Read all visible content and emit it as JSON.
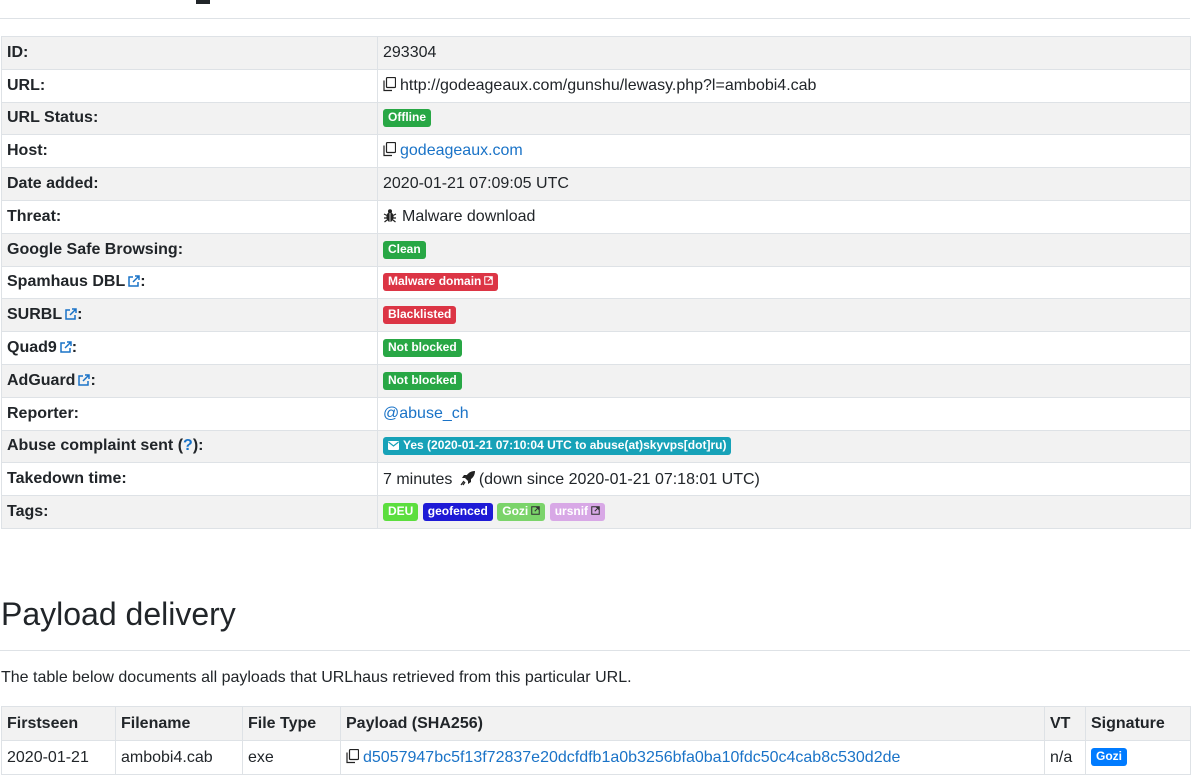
{
  "info_rows": {
    "id": {
      "label": "ID:",
      "value": "293304"
    },
    "url": {
      "label": "URL:",
      "value": "http://godeageaux.com/gunshu/lewasy.php?l=ambobi4.cab"
    },
    "url_status": {
      "label": "URL Status:",
      "badge": "Offline"
    },
    "host": {
      "label": "Host:",
      "value": "godeageaux.com"
    },
    "date_added": {
      "label": "Date added:",
      "value": "2020-01-21 07:09:05 UTC"
    },
    "threat": {
      "label": "Threat:",
      "value": "Malware download"
    },
    "google_safe_browsing": {
      "label": "Google Safe Browsing:",
      "badge": "Clean"
    },
    "spamhaus_dbl": {
      "label": "Spamhaus DBL",
      "badge": "Malware domain"
    },
    "surbl": {
      "label": "SURBL",
      "badge": "Blacklisted"
    },
    "quad9": {
      "label": "Quad9",
      "badge": "Not blocked"
    },
    "adguard": {
      "label": "AdGuard",
      "badge": "Not blocked"
    },
    "reporter": {
      "label": "Reporter:",
      "value": "@abuse_ch"
    },
    "abuse_complaint": {
      "label_prefix": "Abuse complaint sent (",
      "help": "?",
      "label_suffix": "):",
      "badge": "Yes (2020-01-21 07:10:04 UTC to abuse(at)skyvps[dot]ru)"
    },
    "takedown": {
      "label": "Takedown time:",
      "value_prefix": "7 minutes",
      "value_suffix": "(down since 2020-01-21 07:18:01 UTC)"
    },
    "tags": {
      "label": "Tags:",
      "items": [
        {
          "text": "DEU",
          "color": "#5cde3e",
          "fg": "#ffffff"
        },
        {
          "text": "geofenced",
          "color": "#1e1ad6",
          "fg": "#ffffff"
        },
        {
          "text": "Gozi",
          "color": "#7bd46a",
          "fg": "#ffffff"
        },
        {
          "text": "ursnif",
          "color": "#d8a8e6",
          "fg": "#ffffff"
        }
      ]
    }
  },
  "colon": ":",
  "payload_section": {
    "title": "Payload delivery",
    "description": "The table below documents all payloads that URLhaus retrieved from this particular URL.",
    "headers": {
      "firstseen": "Firstseen",
      "filename": "Filename",
      "filetype": "File Type",
      "payload": "Payload (SHA256)",
      "vt": "VT",
      "signature": "Signature"
    },
    "rows": [
      {
        "firstseen": "2020-01-21",
        "filename": "ambobi4.cab",
        "filetype": "exe",
        "sha256": "d5057947bc5f13f72837e20dcfdfb1a0b3256bfa0ba10fdc50c4cab8c530d2de",
        "vt": "n/a",
        "signature": "Gozi"
      }
    ]
  },
  "colors": {
    "green": "#28a745",
    "red": "#dc3545",
    "teal": "#17a2b8",
    "link": "#1a73c7"
  }
}
